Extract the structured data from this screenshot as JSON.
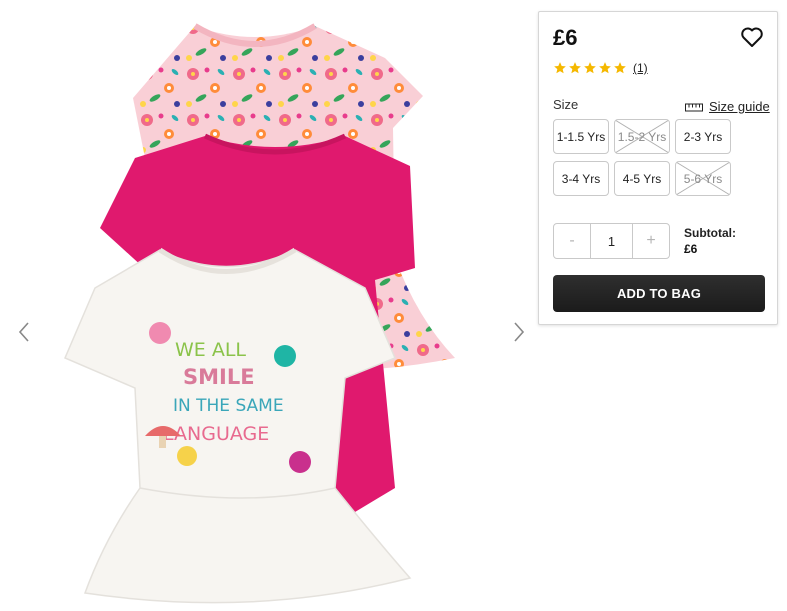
{
  "product": {
    "image_alt": "Three girls' peplum t-shirts: floral print, pink, and white slogan tee",
    "slogan_lines": [
      "WE ALL",
      "SMILE",
      "IN THE SAME",
      "LANGUAGE"
    ]
  },
  "gallery": {
    "prev_icon": "chevron-left-icon",
    "next_icon": "chevron-right-icon"
  },
  "panel": {
    "price": "£6",
    "wishlist_icon": "heart-outline-icon",
    "rating": {
      "stars": 5,
      "max": 5,
      "count_label": "(1)"
    },
    "size_label": "Size",
    "size_guide_label": "Size guide",
    "sizes": [
      {
        "label": "1-1.5 Yrs",
        "available": true
      },
      {
        "label": "1.5-2 Yrs",
        "available": false
      },
      {
        "label": "2-3 Yrs",
        "available": true
      },
      {
        "label": "3-4 Yrs",
        "available": true
      },
      {
        "label": "4-5 Yrs",
        "available": true
      },
      {
        "label": "5-6 Yrs",
        "available": false
      }
    ],
    "quantity": {
      "minus": "-",
      "value": "1",
      "plus": "+"
    },
    "subtotal_label": "Subtotal:",
    "subtotal_value": "£6",
    "add_to_bag_label": "ADD TO BAG",
    "colors": {
      "star": "#f5b800",
      "button": "#222222"
    }
  }
}
